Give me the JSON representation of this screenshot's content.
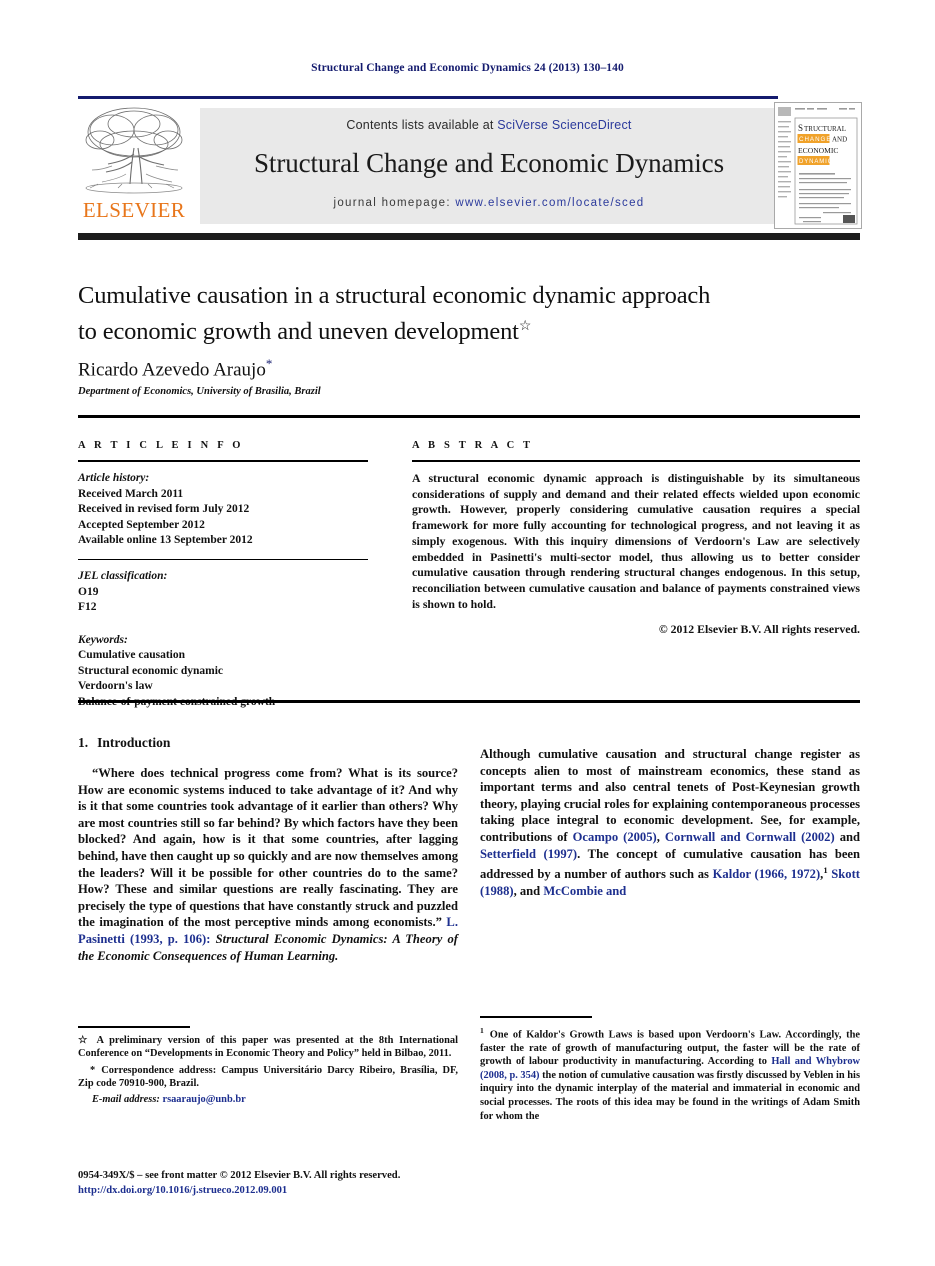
{
  "running_head": "Structural Change and Economic Dynamics 24 (2013) 130–140",
  "masthead": {
    "publisher_logo_label": "ELSEVIER",
    "publisher_logo_icon": "elsevier-tree-icon",
    "contents_prefix": "Contents lists available at ",
    "contents_link": "SciVerse ScienceDirect",
    "journal_title": "Structural Change and Economic Dynamics",
    "homepage_prefix": "journal homepage: ",
    "homepage_url": "www.elsevier.com/locate/sced",
    "cover_thumb_alt": "journal-cover-thumbnail",
    "cover_title_line1": "STRUCTURAL",
    "cover_title_line2": "CHANGE",
    "cover_title_line3": "AND",
    "cover_title_line4": "ECONOMIC",
    "cover_title_line5": "DYNAMICS",
    "accent_orange": "#e8761b",
    "accent_navy": "#141b6e",
    "link_blue": "#2b3a9c",
    "masthead_bg": "#e9e9e9"
  },
  "article": {
    "title_line1": "Cumulative causation in a structural economic dynamic approach",
    "title_line2": "to economic growth and uneven development",
    "title_star": "☆",
    "author": "Ricardo Azevedo Araujo",
    "author_asterisk": "*",
    "affiliation": "Department of Economics, University of Brasilia, Brazil"
  },
  "info": {
    "heading": "A R T I C L E   I N F O",
    "history_label": "Article history:",
    "history": [
      "Received March 2011",
      "Received in revised form July 2012",
      "Accepted September 2012",
      "Available online 13 September 2012"
    ],
    "jel_label": "JEL classification:",
    "jel_codes": [
      "O19",
      "F12"
    ],
    "keywords_label": "Keywords:",
    "keywords": [
      "Cumulative causation",
      "Structural economic dynamic",
      "Verdoorn's law",
      "Balance-of-payment constrained growth"
    ]
  },
  "abstract": {
    "heading": "A B S T R A C T",
    "text": "A structural economic dynamic approach is distinguishable by its simultaneous considerations of supply and demand and their related effects wielded upon economic growth. However, properly considering cumulative causation requires a special framework for more fully accounting for technological progress, and not leaving it as simply exogenous. With this inquiry dimensions of Verdoorn's Law are selectively embedded in Pasinetti's multi-sector model, thus allowing us to better consider cumulative causation through rendering structural changes endogenous. In this setup, reconciliation between cumulative causation and balance of payments constrained views is shown to hold.",
    "copyright": "© 2012 Elsevier B.V. All rights reserved."
  },
  "body": {
    "section_number": "1.",
    "section_title": "Introduction",
    "quote_part1": "“Where does technical progress come from? What is its source? How are economic systems induced to take advantage of it? And why is it that some countries took advantage of it earlier than others? Why are most countries still so far behind? By which factors have they been blocked? And again, how is it that some countries, after lagging behind, have then caught up so quickly and are now themselves among the leaders? Will it be possible for other countries do to the same? How? These and similar questions are really fascinating. They are precisely the type of questions that have constantly struck and puzzled the imagination of the most perceptive minds among economists.”",
    "quote_citation": " L. Pasinetti (1993, p. 106):",
    "quote_source": " Structural Economic Dynamics: A Theory of the Economic Consequences of Human Learning.",
    "para2_a": "Although cumulative causation and structural change register as concepts alien to most of mainstream economics, these stand as important terms and also central tenets of Post-Keynesian growth theory, playing crucial roles for explaining contemporaneous processes taking place integral to economic development. See, for example, contributions of ",
    "ref_ocampo": "Ocampo (2005)",
    "para2_b": ", ",
    "ref_cornwall": "Cornwall and Cornwall (2002)",
    "para2_c": " and ",
    "ref_setterfield": "Setterfield (1997)",
    "para2_d": ". The concept of cumulative causation has been addressed by a number of authors such as ",
    "ref_kaldor": "Kaldor (1966, 1972)",
    "para2_e": ",",
    "para2_footmark": "1",
    "para2_f": " ",
    "ref_skott": "Skott (1988)",
    "para2_g": ", and ",
    "ref_mccombie": "McCombie and"
  },
  "footnotes": {
    "star_marker": "☆",
    "star_text": "A preliminary version of this paper was presented at the 8th International Conference on “Developments in Economic Theory and Policy” held in Bilbao, 2011.",
    "corr_marker": "*",
    "corr_text": "Correspondence address: Campus Universitário Darcy Ribeiro, Brasília, DF, Zip code 70910-900, Brazil.",
    "email_label": "E-mail address:",
    "email_value": "rsaaraujo@unb.br",
    "note1_marker": "1",
    "note1_a": "One of Kaldor's Growth Laws is based upon Verdoorn's Law. Accordingly, the faster the rate of growth of manufacturing output, the faster will be the rate of growth of labour productivity in manufacturing. According to ",
    "note1_ref": "Hall and Whybrow (2008, p. 354)",
    "note1_b": " the notion of cumulative causation was firstly discussed by Veblen in his inquiry into the dynamic interplay of the material and immaterial in economic and social processes. The roots of this idea may be found in the writings of Adam Smith for whom the"
  },
  "footer": {
    "issn_line": "0954-349X/$ – see front matter © 2012 Elsevier B.V. All rights reserved.",
    "doi_line": "http://dx.doi.org/10.1016/j.strueco.2012.09.001"
  }
}
